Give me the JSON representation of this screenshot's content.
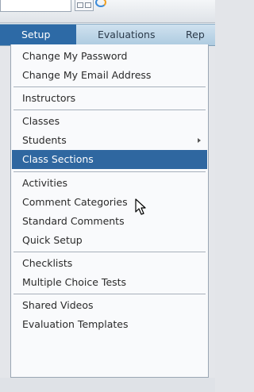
{
  "menubar": {
    "tabs": [
      {
        "label": "Setup"
      },
      {
        "label": "Evaluations"
      },
      {
        "label": "Rep"
      }
    ]
  },
  "setup_menu": {
    "items": [
      {
        "label": "Change My Password"
      },
      {
        "label": "Change My Email Address"
      },
      {
        "label": "Instructors"
      },
      {
        "label": "Classes"
      },
      {
        "label": "Students",
        "has_submenu": true
      },
      {
        "label": "Class Sections",
        "highlighted": true
      },
      {
        "label": "Activities"
      },
      {
        "label": "Comment Categories"
      },
      {
        "label": "Standard Comments"
      },
      {
        "label": "Quick Setup"
      },
      {
        "label": "Checklists"
      },
      {
        "label": "Multiple Choice Tests"
      },
      {
        "label": "Shared Videos"
      },
      {
        "label": "Evaluation Templates"
      }
    ]
  },
  "colors": {
    "menubar_bg": "#bcd6e8",
    "active_tab_bg": "#2d6aa6",
    "highlight_bg": "#2f67a0",
    "dropdown_bg": "#f9fafc"
  },
  "icons": {
    "submenu_arrow": "chevron-right-icon",
    "cursor": "pointer-cursor-icon",
    "browser": "ie-icon"
  }
}
